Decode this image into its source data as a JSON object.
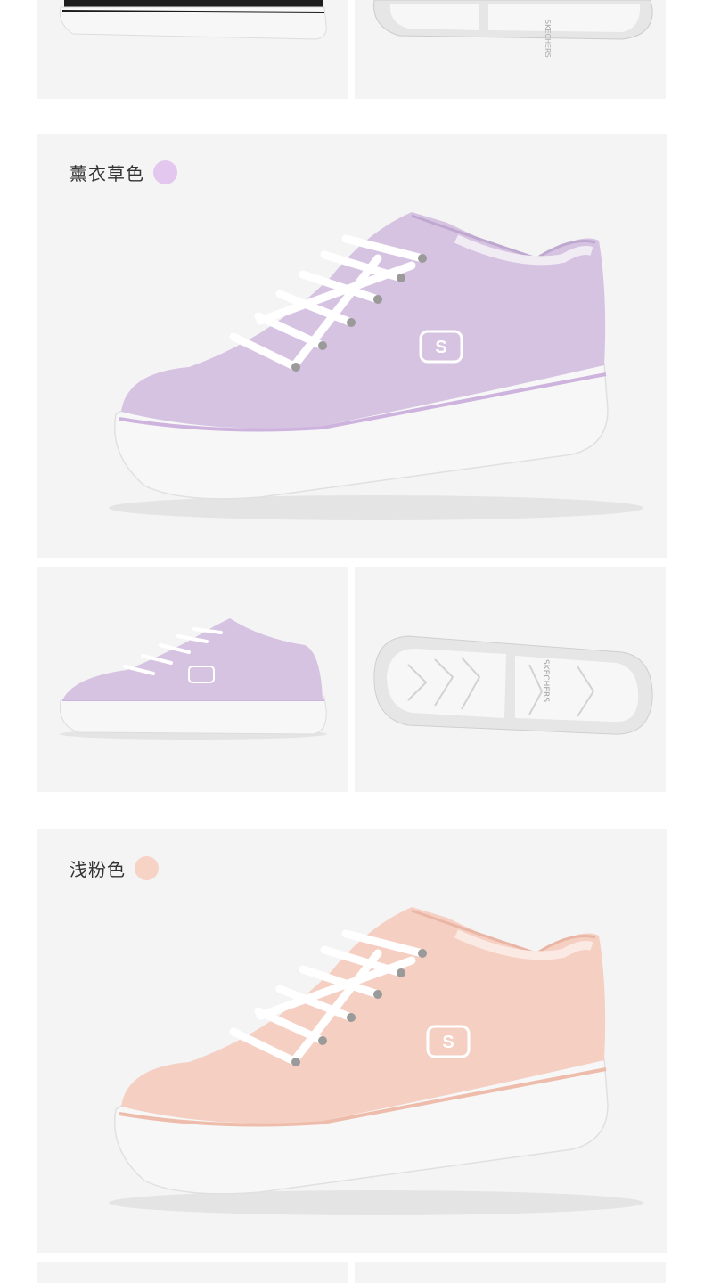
{
  "variants": [
    {
      "name": "薰衣草色",
      "swatch_color": "#e3c7ee",
      "upper_color": "#d6c3e2",
      "stripe_color": "#cdb3dd"
    },
    {
      "name": "浅粉色",
      "swatch_color": "#f7d3c6",
      "upper_color": "#f6cfc3",
      "stripe_color": "#eebcab"
    }
  ],
  "colors": {
    "panel_bg": "#f4f4f4",
    "black_upper": "#1c1c1c",
    "sole_white": "#f7f7f7",
    "outsole_gray": "#e6e6e6"
  },
  "brand_text_on_sole": "SKECHERS"
}
